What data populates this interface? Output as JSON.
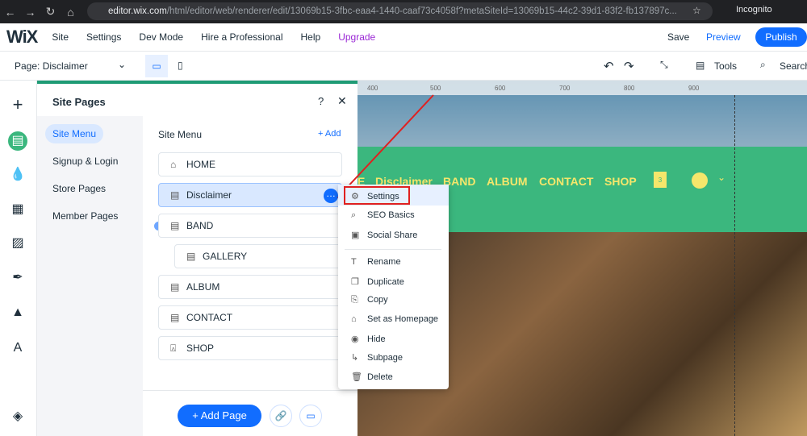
{
  "browser": {
    "url_host": "editor.wix.com",
    "url_path": "/html/editor/web/renderer/edit/13069b15-3fbc-eaa4-1440-caaf73c4058f?metaSiteId=13069b15-44c2-39d1-83f2-fb137897c...",
    "profile": "Incognito"
  },
  "topbar": {
    "logo": "WiX",
    "menu": [
      "Site",
      "Settings",
      "Dev Mode",
      "Hire a Professional",
      "Help",
      "Upgrade"
    ],
    "save": "Save",
    "preview": "Preview",
    "publish": "Publish"
  },
  "toolbar": {
    "page": "Page: Disclaimer",
    "tools": "Tools",
    "search": "Search"
  },
  "panel": {
    "title": "Site Pages",
    "help": "?",
    "side": [
      "Site Menu",
      "Signup & Login",
      "Store Pages",
      "Member Pages"
    ],
    "section": "Site Menu",
    "add": "+ Add",
    "pages": [
      "HOME",
      "Disclaimer",
      "BAND",
      "GALLERY",
      "ALBUM",
      "CONTACT",
      "SHOP"
    ],
    "add_page": "+ Add Page"
  },
  "context_menu": [
    "Settings",
    "SEO Basics",
    "Social Share",
    "Rename",
    "Duplicate",
    "Copy",
    "Set as Homepage",
    "Hide",
    "Subpage",
    "Delete"
  ],
  "site": {
    "nav": [
      "E",
      "Disclaimer",
      "BAND",
      "ALBUM",
      "CONTACT",
      "SHOP"
    ],
    "cart_count": "3",
    "ruler": [
      "400",
      "500",
      "600",
      "700",
      "800",
      "900"
    ]
  },
  "colors": {
    "accent": "#116dff",
    "site_green": "#3bb77e",
    "highlight": "#e02020"
  }
}
